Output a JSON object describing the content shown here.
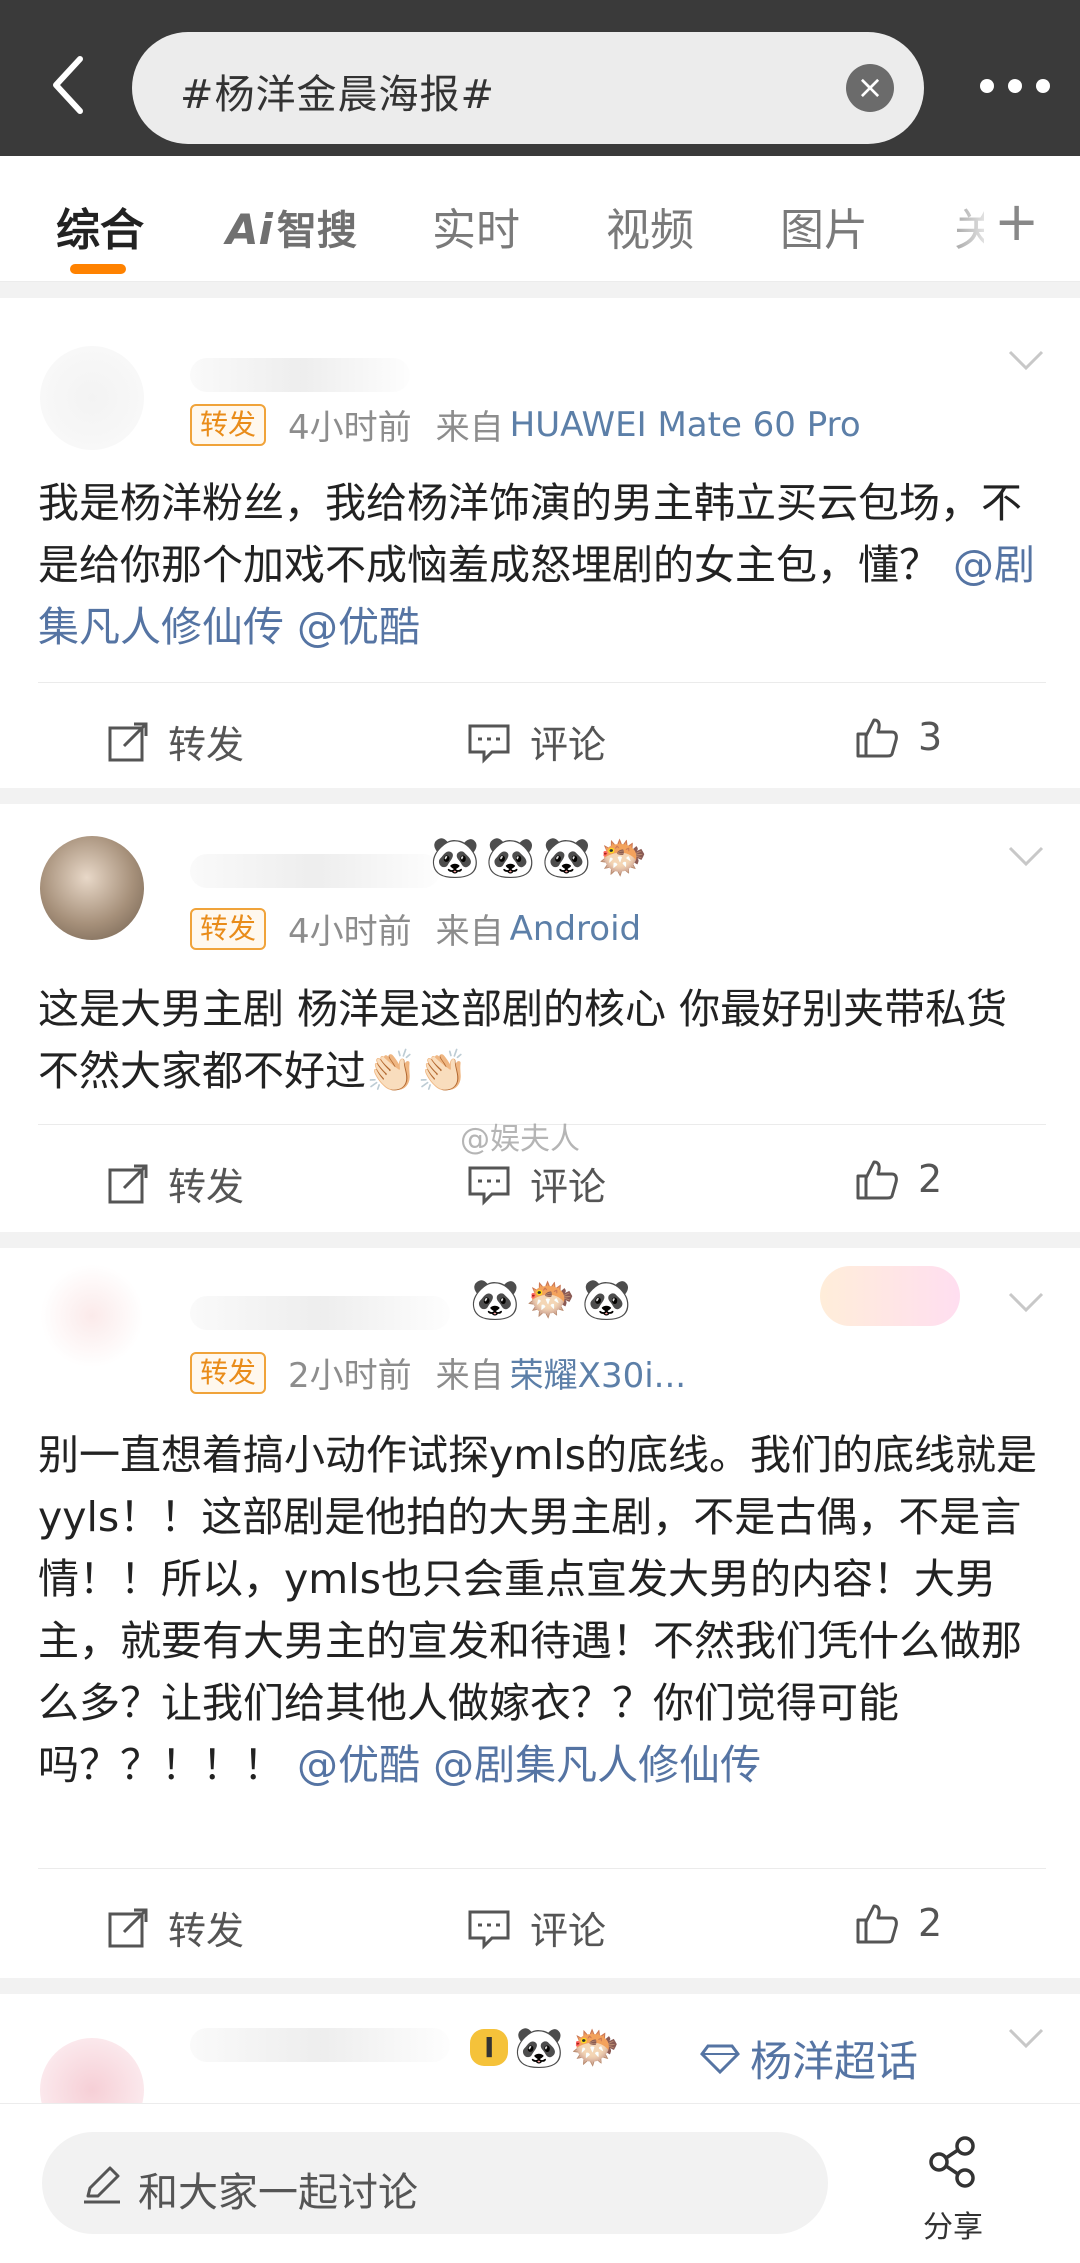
{
  "header": {
    "search_value": "#杨洋金晨海报#"
  },
  "tabs": [
    {
      "label": "综合"
    },
    {
      "label": "Ai",
      "label2": "智搜"
    },
    {
      "label": "实时"
    },
    {
      "label": "视频"
    },
    {
      "label": "图片"
    },
    {
      "label": "关"
    }
  ],
  "posts": [
    {
      "badge": "转发",
      "time": "4小时前",
      "from": "来自",
      "source": "HUAWEI Mate 60 Pro",
      "text": "我是杨洋粉丝，我给杨洋饰演的男主韩立买云包场，不是给你那个加戏不成恼羞成怒埋剧的女主包，懂？",
      "mention1": "@剧集凡人修仙传",
      "mention2": "@优酷",
      "repost": "转发",
      "comment": "评论",
      "likes": "3"
    },
    {
      "badge": "转发",
      "time": "4小时前",
      "from": "来自",
      "source": "Android",
      "text": " 这是大男主剧 杨洋是这部剧的核心 你最好别夹带私货  不然大家都不好过👏🏻👏🏻",
      "repost": "转发",
      "comment": "评论",
      "likes": "2"
    },
    {
      "badge": "转发",
      "time": "2小时前",
      "from": "来自",
      "source": "荣耀X30i...",
      "text": "别一直想着搞小动作试探ymls的底线。我们的底线就是yyls！！这部剧是他拍的大男主剧，不是古偶，不是言情！！所以，ymls也只会重点宣发大男的内容！大男主，就要有大男主的宣发和待遇！不然我们凭什么做那么多？让我们给其他人做嫁衣？？你们觉得可能吗？？！！！",
      "mention1": "@优酷",
      "mention2": "@剧集凡人修仙传",
      "repost": "转发",
      "comment": "评论",
      "likes": "2"
    }
  ],
  "watermark": "@娱夫人",
  "super_topic": "杨洋超话",
  "level_badge": "I",
  "emoji": {
    "panda": "🐼",
    "fish": "🐡"
  },
  "bottom": {
    "placeholder": "和大家一起讨论",
    "share": "分享"
  },
  "colors": {
    "accent": "#ff8200",
    "link": "#5574a3",
    "badge_border": "#f0a33a"
  }
}
